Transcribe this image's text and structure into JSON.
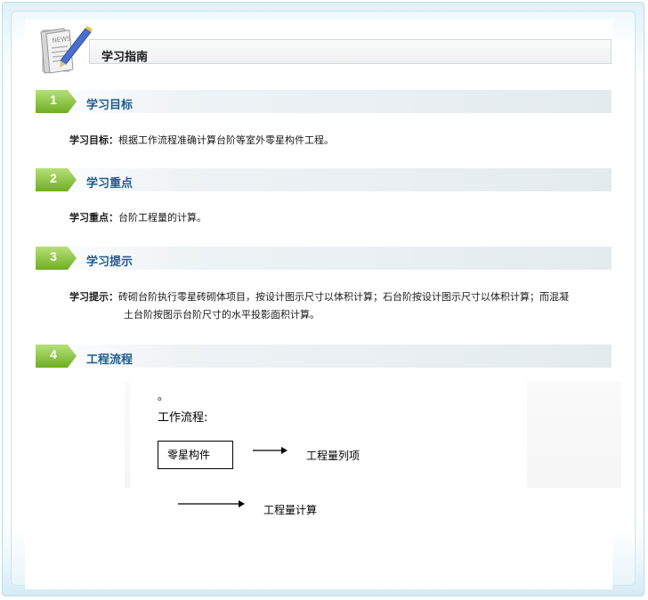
{
  "header": {
    "title": "学习指南",
    "icon": "news-icon"
  },
  "sections": [
    {
      "number": "1",
      "title": "学习目标",
      "label": "学习目标：",
      "text": "根据工作流程准确计算台阶等室外零星构件工程。"
    },
    {
      "number": "2",
      "title": "学习重点",
      "label": "学习重点：",
      "text": "台阶工程量的计算。"
    },
    {
      "number": "3",
      "title": "学习提示",
      "label": "学习提示：",
      "text_line1": "砖砌台阶执行零星砖砌体项目，按设计图示尺寸以体积计算；石台阶按设计图示尺寸以体积计算；而混凝",
      "text_line2": "土台阶按图示台阶尺寸的水平投影面积计算。"
    },
    {
      "number": "4",
      "title": "工程流程"
    }
  ],
  "flow": {
    "dot": "。",
    "label": "工作流程:",
    "box_label": "零星构件",
    "step2": "工程量列项",
    "step3": "工程量计算"
  },
  "colors": {
    "badge_green": "#8cc63f",
    "section_title": "#1d5d8c",
    "frame": "#b9dce6"
  }
}
